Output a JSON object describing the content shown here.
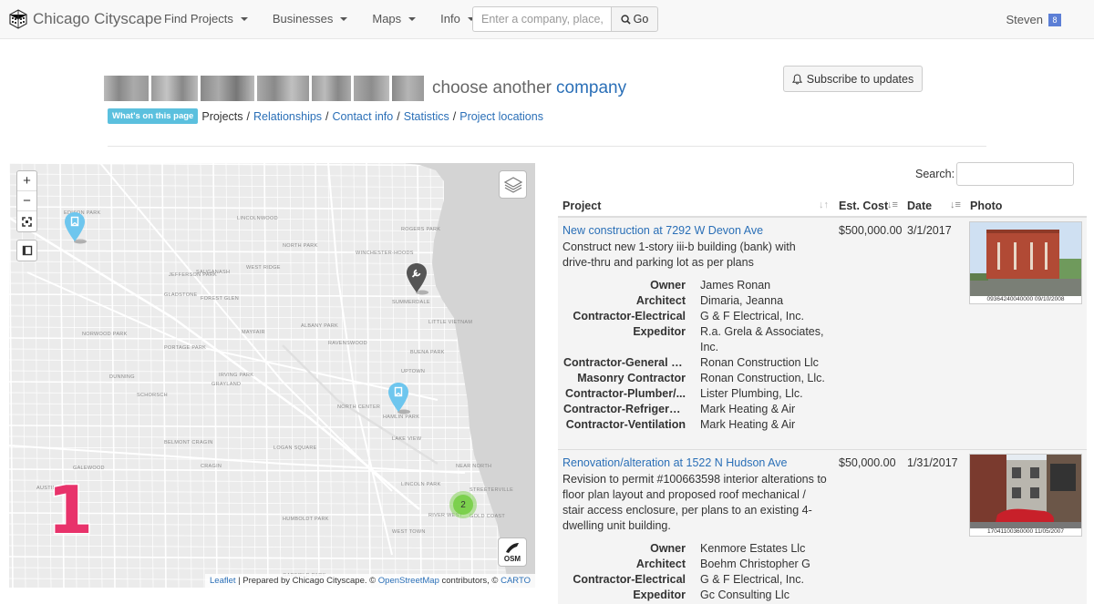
{
  "navbar": {
    "brand": "Chicago Cityscape",
    "menu": [
      "Find Projects",
      "Businesses",
      "Maps",
      "Info"
    ],
    "search_placeholder": "Enter a company, place, address",
    "search_button": "Go",
    "user": "Steven",
    "user_badge": "8"
  },
  "header": {
    "title_suffix": "choose another",
    "title_link": "company",
    "subscribe_label": "Subscribe to updates",
    "whats_on_page": "What's on this page",
    "page_links": [
      "Projects",
      "Relationships",
      "Contact info",
      "Statistics",
      "Project locations"
    ]
  },
  "map": {
    "zoom_in": "+",
    "zoom_out": "−",
    "cluster_count": "2",
    "overlay_number": "1",
    "osm_label": "OSM",
    "attribution": {
      "leaflet": "Leaflet",
      "text1": " | Prepared by Chicago Cityscape. © ",
      "osm": "OpenStreetMap",
      "text2": " contributors, © ",
      "carto": "CARTO"
    },
    "place_labels": [
      "EDISON PARK",
      "LINCOLNWOOD",
      "NORTH PARK",
      "WEST RIDGE",
      "ROGERS PARK",
      "WINCHESTER-HOODS",
      "GOLD COAST",
      "UPTOWN",
      "LAKE VIEW",
      "LINCOLN PARK",
      "LOGAN SQUARE",
      "HUMBOLDT PARK",
      "WEST TOWN",
      "PORTAGE PARK",
      "JEFFERSON PARK",
      "IRVING PARK",
      "DUNNING",
      "NORWOOD PARK",
      "BELMONT CRAGIN",
      "AUSTIN",
      "NORTH CENTER",
      "ALBANY PARK",
      "SAUGANASH",
      "FOREST GLEN",
      "SUMMERDALE",
      "LITTLE VIETNAM",
      "BUENA PARK",
      "HAMLIN PARK",
      "RAVENSWOOD",
      "MAYFAIR",
      "GRAYLAND",
      "GLADSTONE",
      "SCHORSCH",
      "CRAGIN",
      "GARFIELD PARK",
      "NEAR NORTH",
      "STREETERVILLE",
      "RIVER WEST",
      "GALEWOOD"
    ]
  },
  "table": {
    "search_label": "Search:",
    "headers": [
      "Project",
      "Est. Cost",
      "Date",
      "Photo"
    ],
    "rows": [
      {
        "title": "New construction at 7292 W Devon Ave",
        "description": "Construct new 1-story iii-b building (bank) with drive-thru and parking lot as per plans",
        "cost": "$500,000.00",
        "date": "3/1/2017",
        "photo_caption": "09364240040000  09/10/2008",
        "roles": [
          {
            "k": "Owner",
            "v": "James Ronan"
          },
          {
            "k": "Architect",
            "v": "Dimaria, Jeanna"
          },
          {
            "k": "Contractor-Electrical",
            "v": "G & F Electrical, Inc."
          },
          {
            "k": "Expeditor",
            "v": "R.a. Grela & Associates, Inc."
          },
          {
            "k": "Contractor-General C...",
            "v": "Ronan Construction Llc"
          },
          {
            "k": "Masonry Contractor",
            "v": "Ronan Construction, Llc."
          },
          {
            "k": "Contractor-Plumber/...",
            "v": "Lister Plumbing, Llc."
          },
          {
            "k": "Contractor-Refrigerat...",
            "v": "Mark Heating & Air"
          },
          {
            "k": "Contractor-Ventilation",
            "v": "Mark Heating & Air"
          }
        ]
      },
      {
        "title": "Renovation/alteration at 1522 N Hudson Ave",
        "description": "Revision to permit #100663598 interior alterations to floor plan layout and proposed roof mechanical / stair access enclosure, per plans to an existing 4-dwelling unit building.",
        "cost": "$50,000.00",
        "date": "1/31/2017",
        "photo_caption": "17041100360000  11/05/2007",
        "roles": [
          {
            "k": "Owner",
            "v": "Kenmore Estates Llc"
          },
          {
            "k": "Architect",
            "v": "Boehm Christopher G"
          },
          {
            "k": "Contractor-Electrical",
            "v": "G & F Electrical, Inc."
          },
          {
            "k": "Expeditor",
            "v": "Gc Consulting Llc"
          }
        ]
      }
    ]
  }
}
